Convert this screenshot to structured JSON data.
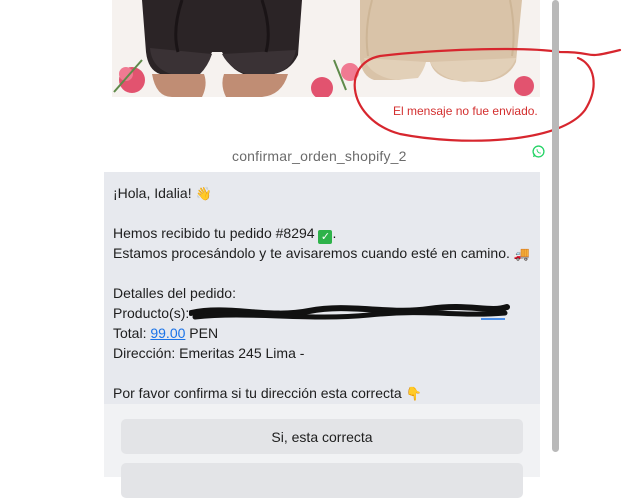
{
  "error": {
    "text": "El mensaje no fue enviado."
  },
  "template": {
    "name": "confirmar_orden_shopify_2",
    "channel_icon": "whatsapp-icon"
  },
  "message": {
    "greeting": "¡Hola, Idalia!",
    "greeting_emoji": "👋",
    "received": "Hemos recibido tu pedido #8294",
    "received_emoji": "✅",
    "received_end": ".",
    "processing": "Estamos procesándolo y te avisaremos cuando esté en camino.",
    "processing_emoji": "🚚",
    "details_heading": "Detalles del pedido:",
    "products_label": "Producto(s):",
    "total_label": "Total:",
    "total_amount": "99.00",
    "total_currency": "PEN",
    "address_label": "Dirección:",
    "address_value": "Emeritas 245 Lima -",
    "confirm_prompt": "Por favor confirma si tu dirección esta correcta",
    "confirm_emoji": "👇"
  },
  "buttons": {
    "confirm_label": "Si, esta correcta"
  },
  "colors": {
    "error_red": "#d32f2f",
    "link_blue": "#1a73e8",
    "whatsapp_green": "#25d366",
    "card_bg": "#e7e9ee"
  }
}
